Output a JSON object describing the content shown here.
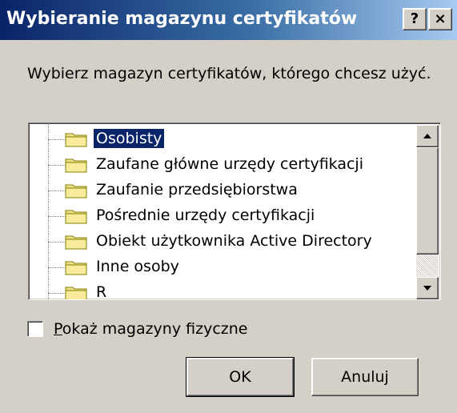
{
  "window": {
    "title": "Wybieranie magazynu certyfikatów",
    "help_label": "?",
    "close_label": "×"
  },
  "instruction": "Wybierz magazyn certyfikatów, którego chcesz użyć.",
  "tree": {
    "items": [
      {
        "label": "Osobisty",
        "selected": true
      },
      {
        "label": "Zaufane główne urzędy certyfikacji"
      },
      {
        "label": "Zaufanie przedsiębiorstwa"
      },
      {
        "label": "Pośrednie urzędy certyfikacji"
      },
      {
        "label": "Obiekt użytkownika Active Directory"
      },
      {
        "label": "Inne osoby"
      },
      {
        "label": "R"
      }
    ],
    "icon": "folder-icon",
    "folder_color": "#f0e08c"
  },
  "checkbox": {
    "label": "Pokaż magazyny fizyczne",
    "checked": false
  },
  "buttons": {
    "ok_label": "OK",
    "cancel_label": "Anuluj"
  },
  "colors": {
    "title_start": "#0a246a",
    "title_end": "#a6caf0",
    "dialog_bg": "#d4d0c8",
    "selection": "#0a246a"
  }
}
